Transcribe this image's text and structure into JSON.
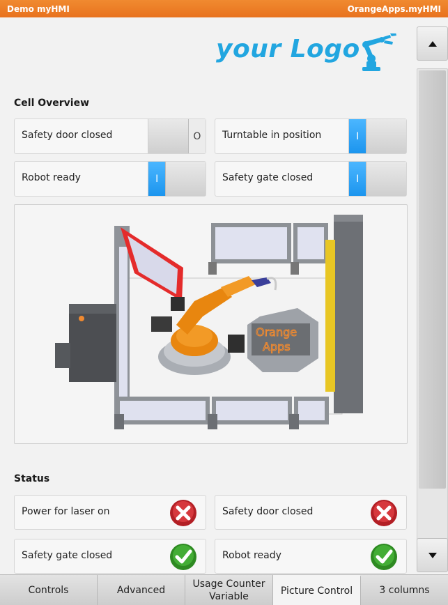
{
  "titlebar": {
    "left": "Demo myHMI",
    "right": "OrangeApps.myHMI"
  },
  "logo": {
    "text": "your Logo",
    "icon": "robot-arm-icon",
    "color": "#22a6e0"
  },
  "cell_overview": {
    "title": "Cell Overview",
    "switches": [
      {
        "label": "Safety door closed",
        "state": "O",
        "on": false
      },
      {
        "label": "Turntable in position",
        "state": "I",
        "on": true
      },
      {
        "label": "Robot ready",
        "state": "I",
        "on": true
      },
      {
        "label": "Safety gate closed",
        "state": "I",
        "on": true
      }
    ]
  },
  "picture": {
    "turntable_text_1": "Orange",
    "turntable_text_2": "Apps"
  },
  "status": {
    "title": "Status",
    "items": [
      {
        "label": "Power for laser on",
        "ok": false,
        "icon": "red-x-icon"
      },
      {
        "label": "Safety door closed",
        "ok": false,
        "icon": "red-x-icon"
      },
      {
        "label": "Safety gate closed",
        "ok": true,
        "icon": "green-check-icon"
      },
      {
        "label": "Robot ready",
        "ok": true,
        "icon": "green-check-icon"
      }
    ]
  },
  "scroll": {
    "up_icon": "arrow-up-icon",
    "down_icon": "arrow-down-icon"
  },
  "tabs": [
    {
      "label": "Controls",
      "active": false
    },
    {
      "label": "Advanced",
      "active": false
    },
    {
      "label": "Usage Counter Variable",
      "line1": "Usage Counter",
      "line2": "Variable",
      "active": false
    },
    {
      "label": "Picture Control",
      "active": true
    },
    {
      "label": "3 columns",
      "active": false
    }
  ],
  "colors": {
    "accent": "#e8721e",
    "toggle_on": "#1c95ee",
    "ok": "#3aa52c",
    "error": "#c8252c"
  }
}
